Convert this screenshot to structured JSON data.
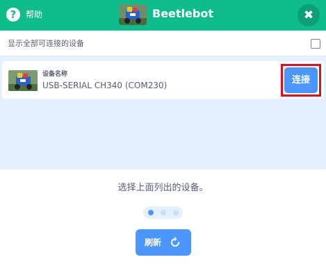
{
  "header": {
    "help_icon": "help-icon",
    "help_label": "帮助",
    "title": "Beetlebot",
    "close_icon": "close-icon"
  },
  "show_all": {
    "label": "显示全部可连接的设备",
    "checked": false
  },
  "device": {
    "label": "设备名称",
    "name": "USB-SERIAL CH340 (COM230)",
    "connect_label": "连接"
  },
  "message": "选择上面列出的设备。",
  "pagination": {
    "count": 3,
    "active_index": 0
  },
  "refresh": {
    "label": "刷新",
    "icon": "refresh-icon"
  },
  "colors": {
    "header_bg": "#0fbd8c",
    "accent": "#4c97ff",
    "device_area_bg": "#e5f0ff",
    "text": "#575e75",
    "highlight": "#e0101a"
  }
}
